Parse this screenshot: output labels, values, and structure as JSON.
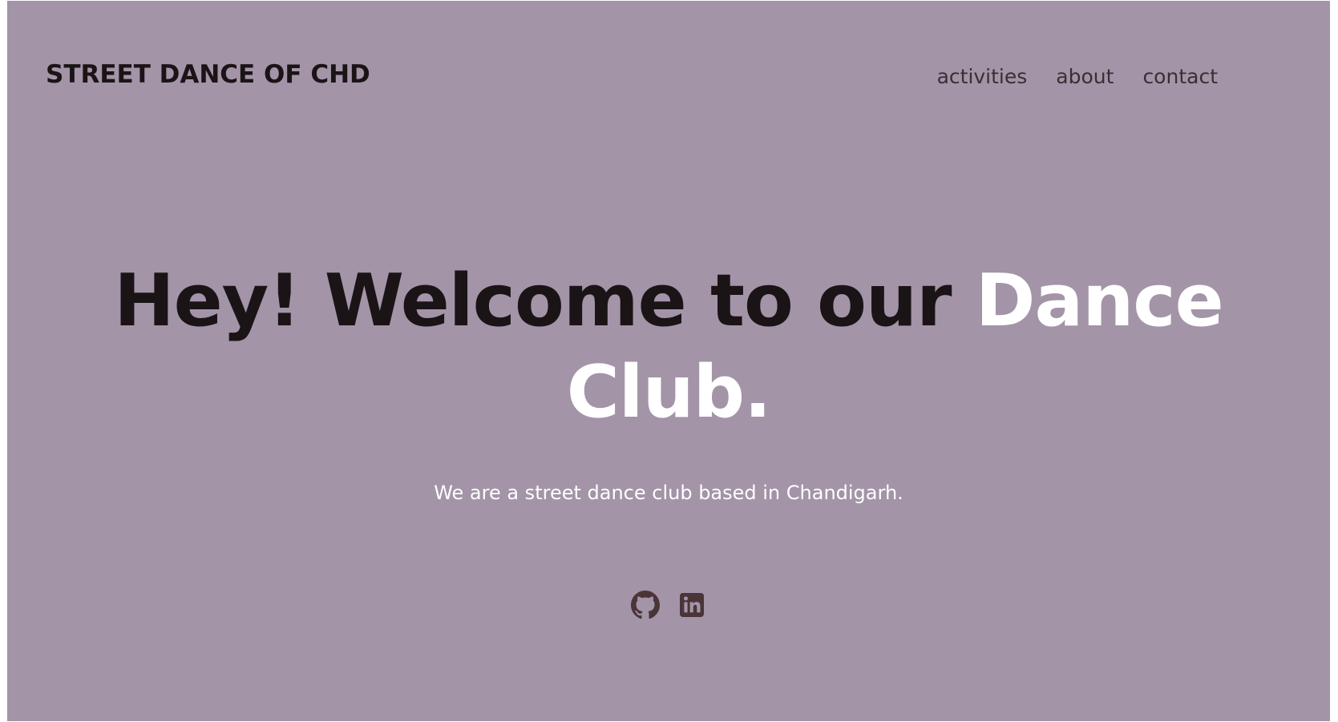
{
  "brand": {
    "title": "STREET DANCE OF CHD"
  },
  "nav": {
    "items": [
      {
        "label": "activities"
      },
      {
        "label": "about"
      },
      {
        "label": "contact"
      }
    ]
  },
  "hero": {
    "title_main": "Hey! Welcome to our ",
    "title_accent": "Dance Club.",
    "subtitle": "We are a street dance club based in Chandigarh."
  },
  "socials": {
    "icons": [
      "github-icon",
      "linkedin-icon"
    ]
  },
  "colors": {
    "background": "#a394a8",
    "text_dark": "#1b1416",
    "accent": "#ffffff",
    "icon": "#4a3438"
  }
}
